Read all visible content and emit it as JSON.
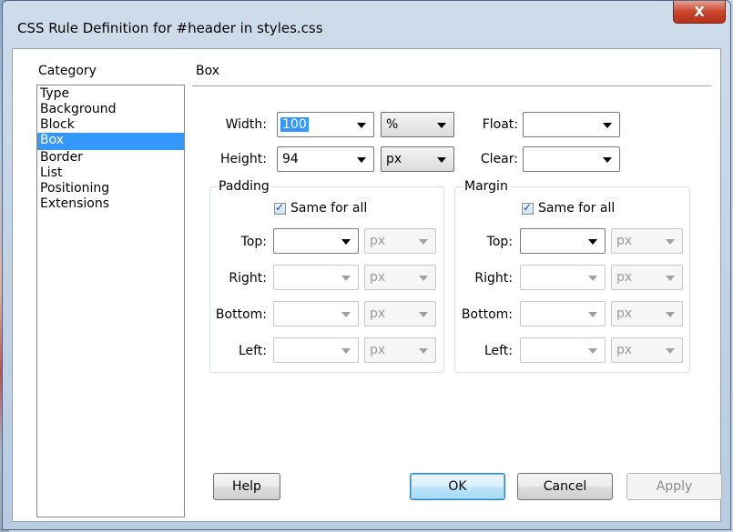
{
  "window": {
    "title": "CSS Rule Definition for #header in styles.css",
    "close_glyph": "X"
  },
  "category": {
    "label": "Category",
    "items": [
      "Type",
      "Background",
      "Block",
      "Box",
      "Border",
      "List",
      "Positioning",
      "Extensions"
    ],
    "selected": "Box"
  },
  "section": {
    "title": "Box"
  },
  "width": {
    "label": "Width:",
    "value": "100",
    "unit": "%"
  },
  "height": {
    "label": "Height:",
    "value": "94",
    "unit": "px"
  },
  "float": {
    "label": "Float:",
    "value": ""
  },
  "clear": {
    "label": "Clear:",
    "value": ""
  },
  "padding": {
    "title": "Padding",
    "same_for_all": "Same for all",
    "same_checked": true,
    "top": {
      "label": "Top:",
      "value": "",
      "unit": "px"
    },
    "right": {
      "label": "Right:",
      "value": "",
      "unit": "px"
    },
    "bottom": {
      "label": "Bottom:",
      "value": "",
      "unit": "px"
    },
    "left": {
      "label": "Left:",
      "value": "",
      "unit": "px"
    }
  },
  "margin": {
    "title": "Margin",
    "same_for_all": "Same for all",
    "same_checked": true,
    "top": {
      "label": "Top:",
      "value": "",
      "unit": "px"
    },
    "right": {
      "label": "Right:",
      "value": "",
      "unit": "px"
    },
    "bottom": {
      "label": "Bottom:",
      "value": "",
      "unit": "px"
    },
    "left": {
      "label": "Left:",
      "value": "",
      "unit": "px"
    }
  },
  "buttons": {
    "help": "Help",
    "ok": "OK",
    "cancel": "Cancel",
    "apply": "Apply"
  },
  "colors": {
    "selection": "#3399ff",
    "close_button": "#c8442c"
  }
}
